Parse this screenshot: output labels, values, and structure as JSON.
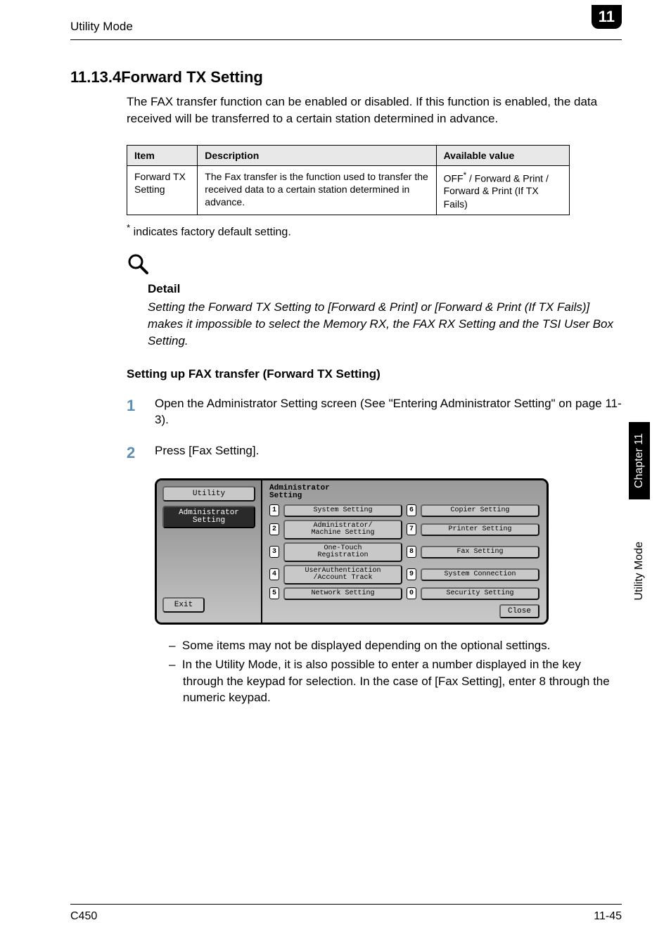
{
  "header": {
    "title": "Utility Mode",
    "badge": "11"
  },
  "section": {
    "heading": "11.13.4Forward TX Setting",
    "intro": "The FAX transfer function can be enabled or disabled. If this function is enabled, the data received will be transferred to a certain station determined in advance."
  },
  "table": {
    "headers": {
      "item": "Item",
      "desc": "Description",
      "avail": "Available value"
    },
    "rows": [
      {
        "item": "Forward TX Setting",
        "desc": "The Fax transfer is the function used to transfer the received data to a certain station determined in advance.",
        "avail_prefix": "OFF",
        "avail_suffix": " / Forward & Print / Forward & Print (If TX Fails)"
      }
    ]
  },
  "footnote": " indicates factory default setting.",
  "detail": {
    "label": "Detail",
    "text": "Setting the Forward TX Setting to [Forward & Print] or [Forward & Print (If TX Fails)] makes it impossible to select the Memory RX, the FAX RX Setting and the TSI User Box Setting."
  },
  "procedure": {
    "title": "Setting up FAX transfer (Forward TX Setting)",
    "steps": [
      {
        "num": "1",
        "text": "Open the Administrator Setting screen (See \"Entering Administrator Setting\" on page 11-3)."
      },
      {
        "num": "2",
        "text": "Press [Fax Setting]."
      }
    ]
  },
  "panel": {
    "left": {
      "utility": "Utility",
      "admin": "Administrator\nSetting",
      "exit": "Exit"
    },
    "title": "Administrator\nSetting",
    "items": [
      {
        "n": "1",
        "label": "System Setting"
      },
      {
        "n": "6",
        "label": "Copier Setting"
      },
      {
        "n": "2",
        "label": "Administrator/\nMachine Setting"
      },
      {
        "n": "7",
        "label": "Printer Setting"
      },
      {
        "n": "3",
        "label": "One-Touch\nRegistration"
      },
      {
        "n": "8",
        "label": "Fax Setting"
      },
      {
        "n": "4",
        "label": "UserAuthentication\n/Account Track"
      },
      {
        "n": "9",
        "label": "System Connection"
      },
      {
        "n": "5",
        "label": "Network Setting"
      },
      {
        "n": "0",
        "label": "Security Setting"
      }
    ],
    "close": "Close"
  },
  "notes": [
    "Some items may not be displayed depending on the optional settings.",
    "In the Utility Mode, it is also possible to enter a number displayed in the key through the keypad for selection. In the case of [Fax Setting], enter 8 through the numeric keypad."
  ],
  "side": {
    "tab": "Chapter 11",
    "label": "Utility Mode"
  },
  "footer": {
    "left": "C450",
    "right": "11-45"
  }
}
